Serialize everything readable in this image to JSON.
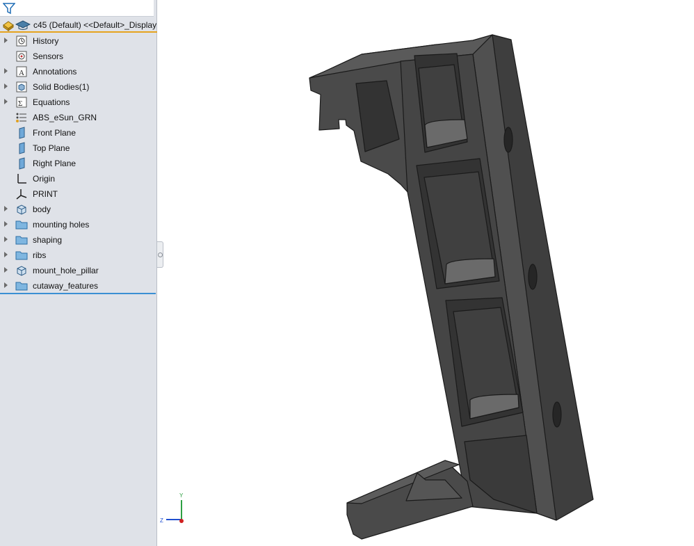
{
  "feature_manager": {
    "part_title": "c45 (Default) <<Default>_Display",
    "tree_items": [
      {
        "label": "History",
        "expandable": true,
        "icon": "history-icon"
      },
      {
        "label": "Sensors",
        "expandable": false,
        "icon": "sensors-icon"
      },
      {
        "label": "Annotations",
        "expandable": true,
        "icon": "annotations-icon"
      },
      {
        "label": "Solid Bodies(1)",
        "expandable": true,
        "icon": "solid-bodies-icon"
      },
      {
        "label": "Equations",
        "expandable": true,
        "icon": "equations-icon"
      },
      {
        "label": "ABS_eSun_GRN",
        "expandable": false,
        "icon": "material-icon"
      },
      {
        "label": "Front Plane",
        "expandable": false,
        "icon": "plane-icon"
      },
      {
        "label": "Top Plane",
        "expandable": false,
        "icon": "plane-icon"
      },
      {
        "label": "Right Plane",
        "expandable": false,
        "icon": "plane-icon"
      },
      {
        "label": "Origin",
        "expandable": false,
        "icon": "origin-icon"
      },
      {
        "label": "PRINT",
        "expandable": false,
        "icon": "coordinate-system-icon"
      },
      {
        "label": "body",
        "expandable": true,
        "icon": "feature-icon"
      },
      {
        "label": "mounting holes",
        "expandable": true,
        "icon": "folder-icon"
      },
      {
        "label": "shaping",
        "expandable": true,
        "icon": "folder-icon"
      },
      {
        "label": "ribs",
        "expandable": true,
        "icon": "folder-icon"
      },
      {
        "label": "mount_hole_pillar",
        "expandable": true,
        "icon": "feature-icon"
      },
      {
        "label": "cutaway_features",
        "expandable": true,
        "icon": "folder-icon"
      }
    ]
  },
  "triad": {
    "y_label": "Y",
    "z_label": "Z"
  },
  "colors": {
    "panel_bg": "#dfe2e8",
    "part_underline": "#e6a31e",
    "tree_end_line": "#3a8fd3",
    "model_fill": "#4a4a4a",
    "model_edge": "#1a1a1a"
  }
}
